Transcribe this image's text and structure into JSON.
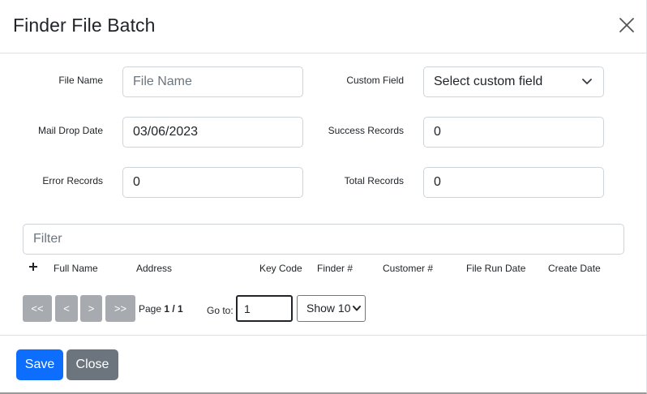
{
  "header": {
    "title": "Finder File Batch"
  },
  "form": {
    "file_name": {
      "label": "File Name",
      "placeholder": "File Name",
      "value": ""
    },
    "custom_field": {
      "label": "Custom Field",
      "selected": "Select custom field"
    },
    "mail_drop_date": {
      "label": "Mail Drop Date",
      "value": "03/06/2023"
    },
    "success_records": {
      "label": "Success Records",
      "value": "0"
    },
    "error_records": {
      "label": "Error Records",
      "value": "0"
    },
    "total_records": {
      "label": "Total Records",
      "value": "0"
    }
  },
  "filter": {
    "placeholder": "Filter"
  },
  "table": {
    "columns": [
      "Full Name",
      "Address",
      "Key Code",
      "Finder #",
      "Customer #",
      "File Run Date",
      "Create Date"
    ]
  },
  "pagination": {
    "first": "<<",
    "prev": "<",
    "next": ">",
    "last": ">>",
    "page_label": "Page",
    "page_value": "1 / 1",
    "goto_label": "Go to:",
    "goto_value": "1",
    "show_selected": "Show 10"
  },
  "footer": {
    "save_label": "Save",
    "close_label": "Close"
  },
  "colors": {
    "primary": "#0d6efd",
    "secondary": "#6c757d",
    "pager": "#a7abaf"
  },
  "icons": {
    "close": "close-icon",
    "plus": "plus-icon",
    "chevron": "chevron-down-icon"
  }
}
